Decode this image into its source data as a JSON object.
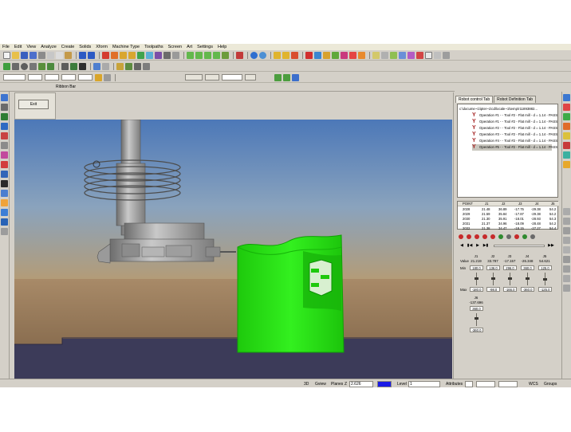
{
  "menu": [
    "File",
    "Edit",
    "View",
    "Analyze",
    "Create",
    "Solids",
    "Xform",
    "Machine Type",
    "Toolpaths",
    "Screen",
    "Art",
    "Settings",
    "Help"
  ],
  "ribbon_bar": {
    "label": "Ribbon Bar",
    "exit_label": "Exit"
  },
  "tabs": [
    {
      "label": "Robot control Tab",
      "active": true
    },
    {
      "label": "Robot Definition Tab",
      "active": false
    }
  ],
  "tree": {
    "root": "c:\\docume~1\\ipter~1\\cd\\locale~1\\temp\\r11893882...",
    "operations": [
      "Operation #1 - - Tool #2 - Flat mill - d = 1.14 - PASS",
      "Operation #1 - - Tool #2 - Flat mill - d = 1.14 - PASS",
      "Operation #2 - - Tool #2 - Flat mill - d = 1.14 - PASS",
      "Operation #3 - - Tool #2 - Flat mill - d = 1.14 - PASS",
      "Operation #4 - - Tool #2 - Flat mill - d = 1.14 - PASS",
      "Operation #5 - - Tool #2 - Flat mill - d = 1.14 - PASS"
    ]
  },
  "points_table": {
    "columns": [
      "POINT",
      "J1",
      "J2",
      "J3",
      "J4",
      "J5"
    ],
    "rows": [
      [
        "2028",
        "21.48",
        "36.89",
        "-17.75",
        "-29.38",
        "54.2"
      ],
      [
        "2029",
        "21.59",
        "35.84",
        "-17.87",
        "-29.38",
        "54.2"
      ],
      [
        "2030",
        "21.30",
        "35.91",
        "-18.01",
        "-28.93",
        "54.3"
      ],
      [
        "2031",
        "21.37",
        "34.96",
        "-18.09",
        "-28.48",
        "54.2"
      ],
      [
        "2032",
        "21.38",
        "34.47",
        "-18.15",
        "-27.27",
        "54.4"
      ]
    ]
  },
  "joints": {
    "headers": [
      "J1",
      "J2",
      "J3",
      "J4",
      "J5"
    ],
    "value_label": "Value",
    "values": [
      "21.219",
      "33.787",
      "-17.157",
      "-26.348",
      "54.621"
    ],
    "min_label": "Min",
    "min": [
      "180.0",
      "136.0",
      "296.0",
      "360.0",
      "125.0"
    ],
    "max_label": "Max",
    "max": [
      "-180.0",
      "-98.0",
      "-166.0",
      "-360.0",
      "-125.0"
    ],
    "levels": [
      0.56,
      0.57,
      0.51,
      0.54,
      0.5
    ],
    "j6_header": "J6",
    "j6_value": "-137.696",
    "j6_min": "360.0",
    "j6_max": "-360.0",
    "j6_level": 0.59
  },
  "statusbar": {
    "mode_3d": "3D",
    "gview": "Gview",
    "planes": "Planes",
    "z_label": "Z",
    "z_value": "2.626",
    "level_label": "Level",
    "level_value": "1",
    "attributes": "Attributes",
    "wcs": "WCS",
    "groups": "Groups"
  },
  "colors": {
    "viewport_sky_top": "#4c78b8",
    "viewport_sky_bottom": "#c6b48e",
    "floor": "#3c3b59",
    "workpiece": "#22dd0e",
    "robot": "#a8a8a8"
  }
}
